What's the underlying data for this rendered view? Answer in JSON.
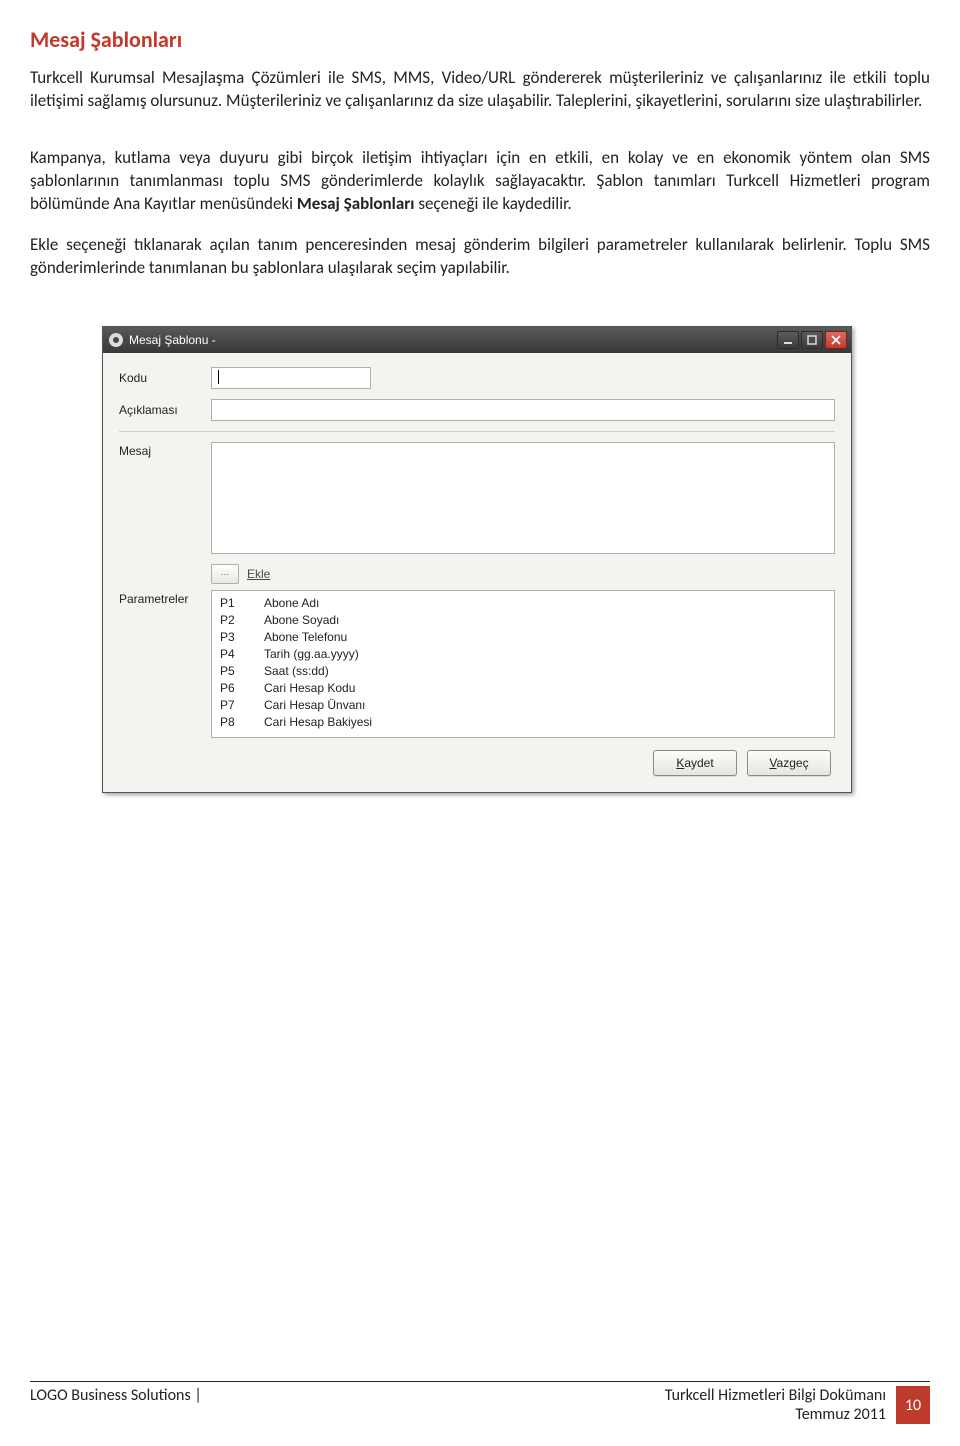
{
  "heading": "Mesaj Şablonları",
  "p1": "Turkcell Kurumsal Mesajlaşma Çözümleri ile SMS, MMS, Video/URL göndererek müşterileriniz ve çalışanlarınız ile etkili toplu iletişimi sağlamış olursunuz. Müşterileriniz ve çalışanlarınız da size ulaşabilir. Taleplerini, şikayetlerini, sorularını size ulaştırabilirler.",
  "p2_a": "Kampanya, kutlama veya duyuru gibi birçok iletişim ihtiyaçları için en etkili, en kolay ve en ekonomik yöntem olan SMS şablonlarının tanımlanması toplu SMS gönderimlerde kolaylık sağlayacaktır. Şablon tanımları Turkcell Hizmetleri program bölümünde Ana Kayıtlar menüsündeki ",
  "p2_bold": "Mesaj Şablonları",
  "p2_b": " seçeneği ile kaydedilir.",
  "p3": "Ekle seçeneği tıklanarak açılan tanım penceresinden mesaj gönderim bilgileri parametreler kullanılarak belirlenir. Toplu SMS gönderimlerinde tanımlanan bu şablonlara ulaşılarak seçim yapılabilir.",
  "dialog": {
    "title": "Mesaj Şablonu -",
    "labels": {
      "kodu": "Kodu",
      "aciklamasi": "Açıklaması",
      "mesaj": "Mesaj",
      "parametreler": "Parametreler"
    },
    "ekle_btn_glyph": "···",
    "ekle": "Ekle",
    "params": [
      {
        "code": "P1",
        "desc": "Abone Adı"
      },
      {
        "code": "P2",
        "desc": "Abone Soyadı"
      },
      {
        "code": "P3",
        "desc": "Abone Telefonu"
      },
      {
        "code": "P4",
        "desc": "Tarih (gg.aa.yyyy)"
      },
      {
        "code": "P5",
        "desc": "Saat (ss:dd)"
      },
      {
        "code": "P6",
        "desc": "Cari Hesap Kodu"
      },
      {
        "code": "P7",
        "desc": "Cari Hesap Ünvanı"
      },
      {
        "code": "P8",
        "desc": "Cari Hesap Bakiyesi"
      }
    ],
    "buttons": {
      "save": "Kaydet",
      "cancel": "Vazgeç"
    }
  },
  "footer": {
    "left": "LOGO Business Solutions |",
    "right1": "Turkcell Hizmetleri Bilgi Dokümanı",
    "right2": "Temmuz 2011",
    "page": "10"
  }
}
